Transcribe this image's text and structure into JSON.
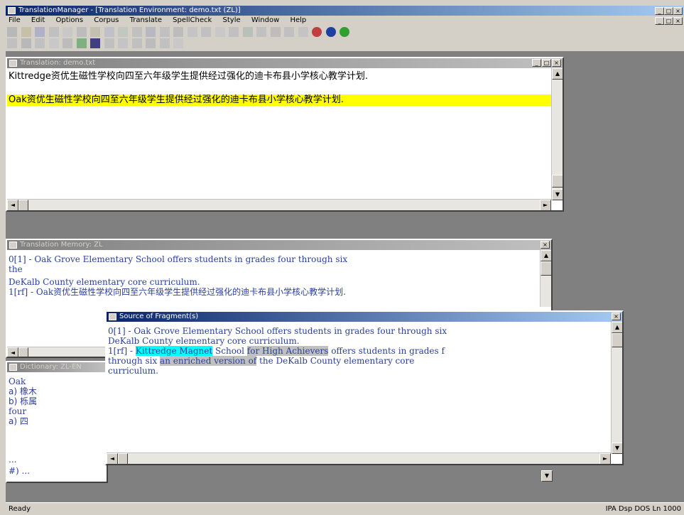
{
  "app": {
    "title": "TranslationManager - [Translation Environment: demo.txt (ZL)]",
    "menu": [
      "File",
      "Edit",
      "Options",
      "Corpus",
      "Translate",
      "SpellCheck",
      "Style",
      "Window",
      "Help"
    ]
  },
  "editor": {
    "title": "Translation: demo.txt",
    "line1": "Kittredge资优生磁性学校向四至六年级学生提供经过强化的迪卡布县小学核心教学计划.",
    "line2": "Oak资优生磁性学校向四至六年级学生提供经过强化的迪卡布县小学核心教学计划."
  },
  "memory": {
    "title": "Translation Memory: ZL",
    "line1": "0[1] - Oak Grove Elementary School offers students in grades four through six",
    "line2": "the",
    "line3": "DeKalb County elementary core curriculum.",
    "line4_prefix": "1[rf] - Oak",
    "line4_zh": "资优生磁性学校向四至六年级学生提供经过强化的迪卡布县小学核心教学计划."
  },
  "dictionary": {
    "title": "Dictionary: ZL-EN",
    "entries": [
      "Oak",
      "a) 橡木",
      "b) 栎属",
      "four",
      "a) 四",
      "...",
      "#) ..."
    ]
  },
  "source": {
    "title": "Source of Fragment(s)",
    "line1": "0[1] - Oak Grove Elementary School offers students in grades four through six",
    "line2": "DeKalb County elementary core curriculum.",
    "line3_prefix": "1[rf] - ",
    "hl_cyan": "Kittredge Magnet",
    "seg_school": " School ",
    "hl_gray1": "for High Achievers",
    "seg_offers": " offers students in grades f",
    "line4_prefix": "through six ",
    "hl_gray2": "an enriched version of",
    "line4_suffix": " the DeKalb County elementary core",
    "line5": "curriculum."
  },
  "status": {
    "left": "Ready",
    "right": "IPA  Dsp  DOS  Ln 1000"
  },
  "colors": {
    "highlight_yellow": "#ffff00",
    "highlight_cyan": "#00ffff",
    "highlight_gray": "#c0c0c0",
    "text_blue": "#2a3f9a"
  }
}
